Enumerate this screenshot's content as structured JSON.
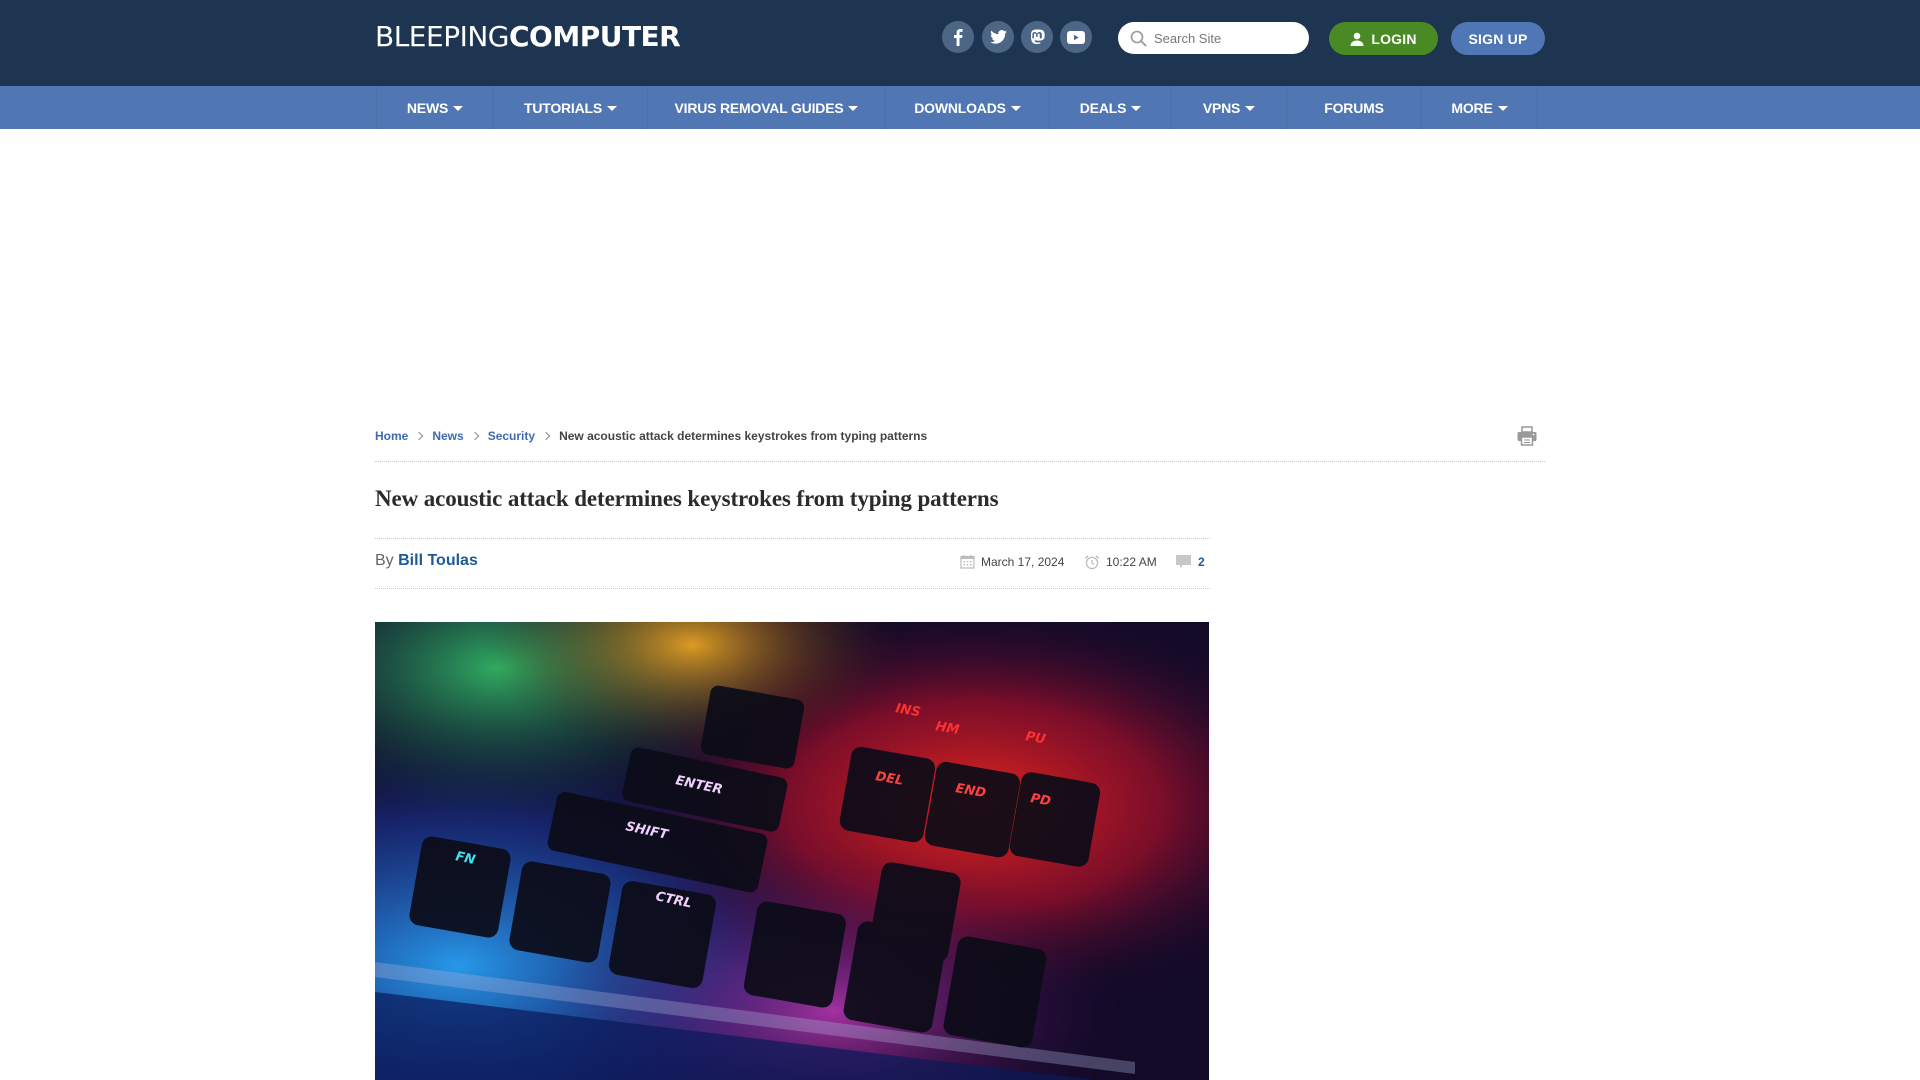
{
  "header": {
    "logo_light": "BLEEPING",
    "logo_bold": "COMPUTER",
    "social": [
      {
        "name": "facebook",
        "icon": "facebook-icon"
      },
      {
        "name": "twitter",
        "icon": "twitter-icon"
      },
      {
        "name": "mastodon",
        "icon": "mastodon-icon"
      },
      {
        "name": "youtube",
        "icon": "youtube-icon"
      }
    ],
    "search_placeholder": "Search Site",
    "login_label": "LOGIN",
    "signup_label": "SIGN UP",
    "colors": {
      "header_bg": "#1e3552",
      "login_bg": "#4a8a24",
      "signup_bg": "#4f76b5"
    }
  },
  "nav": {
    "color": "#5077b4",
    "items": [
      {
        "label": "NEWS",
        "dropdown": true
      },
      {
        "label": "TUTORIALS",
        "dropdown": true
      },
      {
        "label": "VIRUS REMOVAL GUIDES",
        "dropdown": true
      },
      {
        "label": "DOWNLOADS",
        "dropdown": true
      },
      {
        "label": "DEALS",
        "dropdown": true
      },
      {
        "label": "VPNS",
        "dropdown": true
      },
      {
        "label": "FORUMS",
        "dropdown": false
      },
      {
        "label": "MORE",
        "dropdown": true
      }
    ]
  },
  "breadcrumb": {
    "items": [
      "Home",
      "News",
      "Security"
    ],
    "current": "New acoustic attack determines keystrokes from typing patterns"
  },
  "article": {
    "title": "New acoustic attack determines keystrokes from typing patterns",
    "by_prefix": "By",
    "author": "Bill Toulas",
    "date": "March 17, 2024",
    "time": "10:22 AM",
    "comment_count": "2",
    "hero_image_alt": "RGB backlit mechanical keyboard close-up"
  }
}
